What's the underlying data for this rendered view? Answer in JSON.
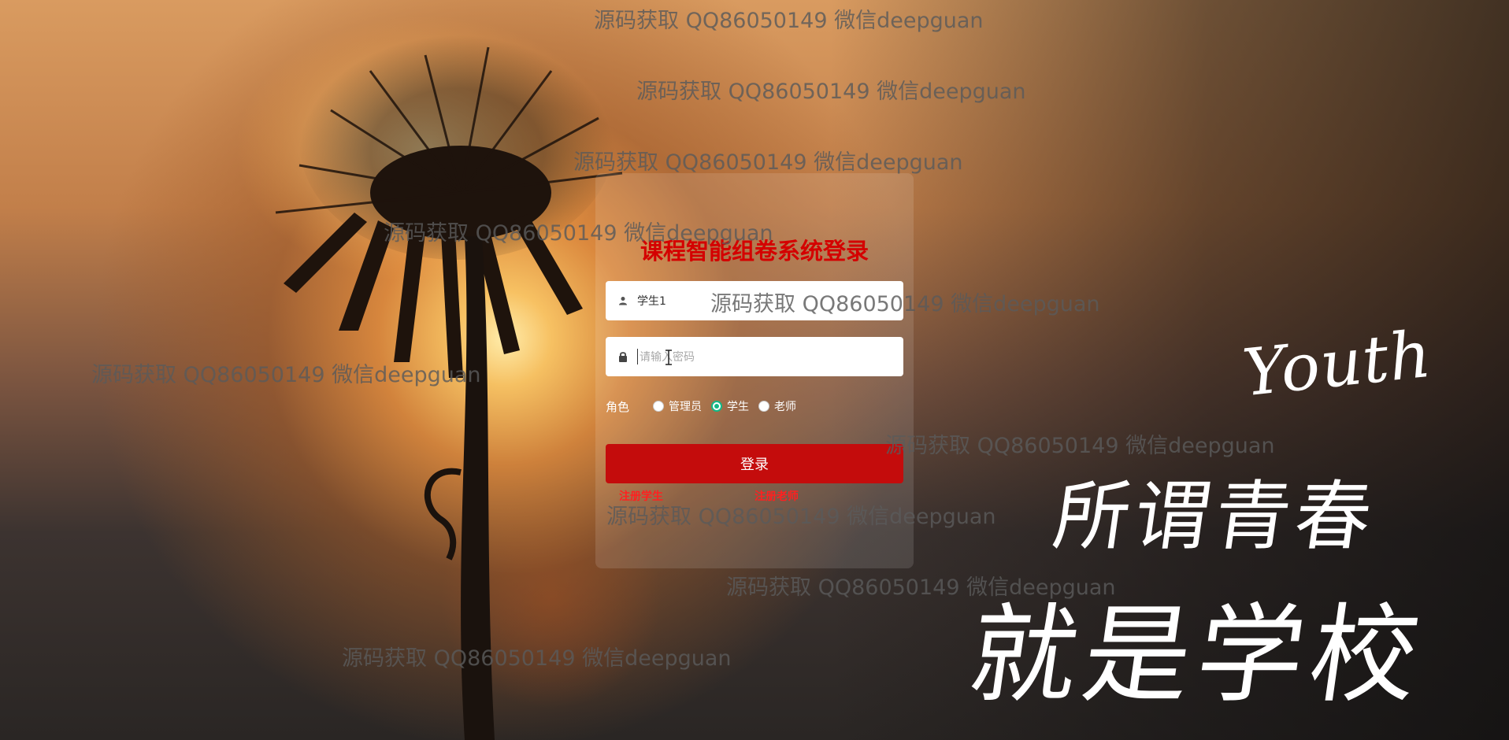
{
  "login": {
    "title": "课程智能组卷系统登录",
    "username_value": "学生1",
    "password_placeholder": "请输入密码",
    "role_label": "角色",
    "roles": [
      "管理员",
      "学生",
      "老师"
    ],
    "selected_role": "学生",
    "submit_label": "登录",
    "register_student": "注册学生",
    "register_teacher": "注册老师"
  },
  "slogan": {
    "youth": "Youth",
    "line1": "所谓青春",
    "line2": "就是学校"
  },
  "watermarks": [
    "源码获取 QQ86050149 微信deepguan",
    "源码获取 QQ86050149 微信deepguan",
    "源码获取 QQ86050149 微信deepguan",
    "源码获取 QQ86050149 微信deepguan",
    "源码获取 QQ86050149 微信deepguan",
    "源码获取 QQ86050149 微信deepguan",
    "源码获取 QQ86050149 微信deepguan",
    "源码获取 QQ86050149 微信deepguan",
    "源码获取 QQ86050149 微信deepguan",
    "源码获取 QQ86050149 微信deepguan"
  ],
  "colors": {
    "title": "#d40000",
    "button": "#c40c0c",
    "link": "#ff2020",
    "radio_checked": "#12b886"
  }
}
